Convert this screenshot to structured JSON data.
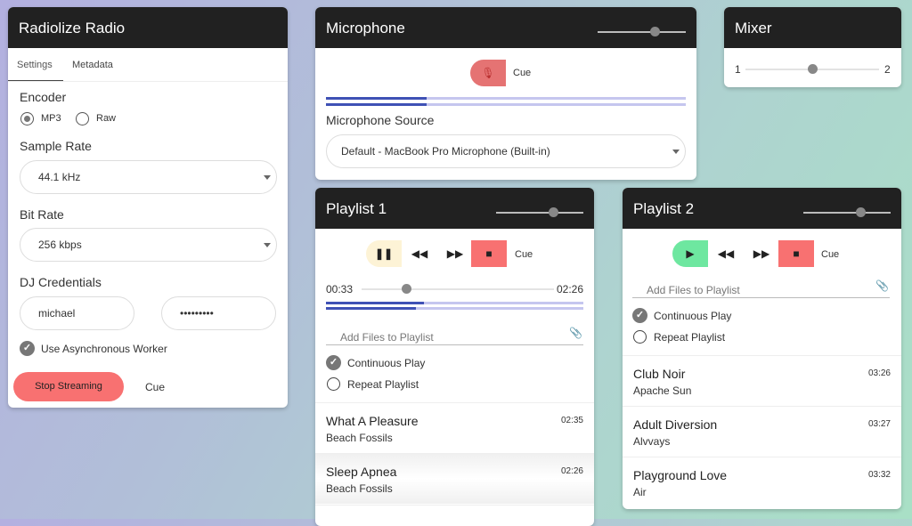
{
  "radio": {
    "title": "Radiolize Radio",
    "tabs": [
      "Settings",
      "Metadata"
    ],
    "encoder_label": "Encoder",
    "encoder_options": [
      "MP3",
      "Raw"
    ],
    "encoder_selected": "MP3",
    "sample_rate_label": "Sample Rate",
    "sample_rate": "44.1 kHz",
    "bit_rate_label": "Bit Rate",
    "bit_rate": "256 kbps",
    "credentials_label": "DJ Credentials",
    "username": "michael",
    "password": "•••••••••",
    "async_label": "Use Asynchronous Worker",
    "async_checked": true,
    "stop_label": "Stop Streaming",
    "cue_label": "Cue"
  },
  "microphone": {
    "title": "Microphone",
    "volume": 0.65,
    "cue_label": "Cue",
    "meter_levels": [
      0.28,
      0.28
    ],
    "source_label": "Microphone Source",
    "source": "Default - MacBook Pro Microphone (Built-in)"
  },
  "mixer": {
    "title": "Mixer",
    "left": "1",
    "right": "2",
    "position": 0.5
  },
  "playlist1": {
    "title": "Playlist 1",
    "volume": 0.65,
    "cue_label": "Cue",
    "state": "playing",
    "elapsed": "00:33",
    "total": "02:26",
    "progress": 0.23,
    "meter_levels": [
      0.38,
      0.35
    ],
    "add_files_placeholder": "Add Files to Playlist",
    "continuous_label": "Continuous Play",
    "continuous": true,
    "repeat_label": "Repeat Playlist",
    "repeat": false,
    "tracks": [
      {
        "title": "What A Pleasure",
        "artist": "Beach Fossils",
        "duration": "02:35"
      },
      {
        "title": "Sleep Apnea",
        "artist": "Beach Fossils",
        "duration": "02:26"
      }
    ]
  },
  "playlist2": {
    "title": "Playlist 2",
    "volume": 0.65,
    "cue_label": "Cue",
    "state": "stopped",
    "add_files_placeholder": "Add Files to Playlist",
    "continuous_label": "Continuous Play",
    "continuous": true,
    "repeat_label": "Repeat Playlist",
    "repeat": false,
    "tracks": [
      {
        "title": "Club Noir",
        "artist": "Apache Sun",
        "duration": "03:26"
      },
      {
        "title": "Adult Diversion",
        "artist": "Alvvays",
        "duration": "03:27"
      },
      {
        "title": "Playground Love",
        "artist": "Air",
        "duration": "03:32"
      }
    ]
  },
  "colors": {
    "header": "#212121",
    "stop": "#f87171",
    "play": "#6ee7a0",
    "pause": "#fdf3d6",
    "meter": "#3f51b5"
  }
}
